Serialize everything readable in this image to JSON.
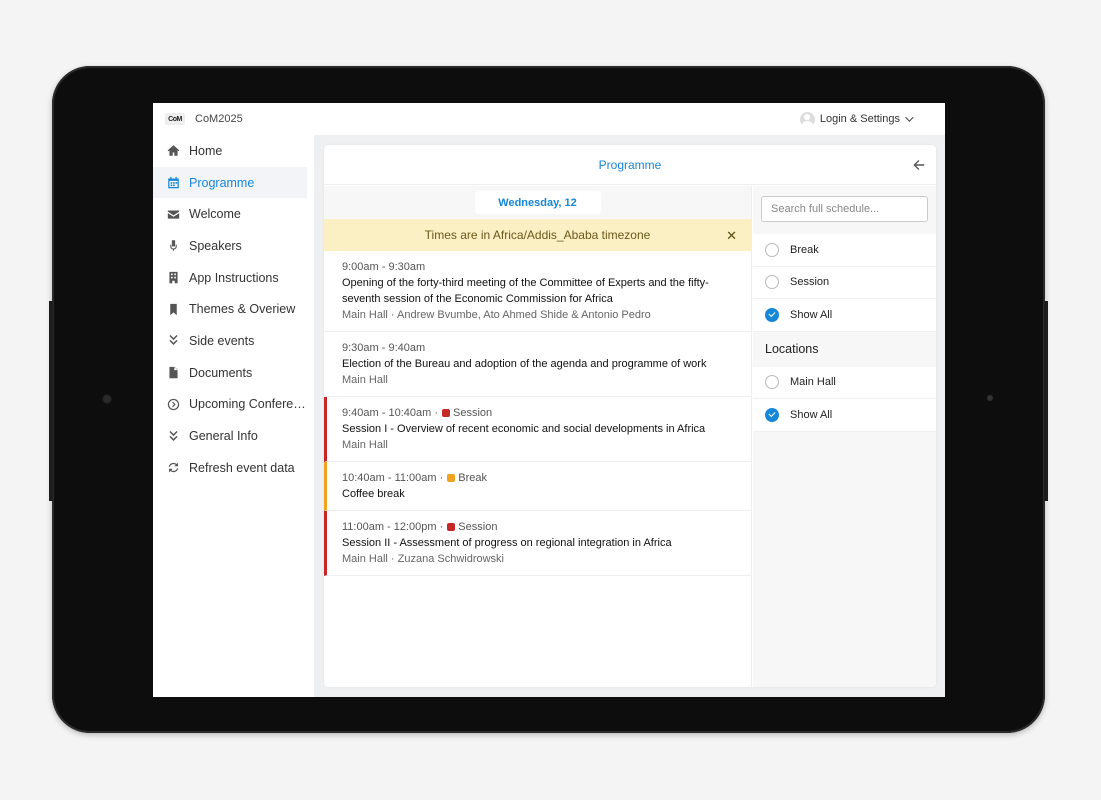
{
  "app": {
    "logo_text": "CoM",
    "title": "CoM2025",
    "login_label": "Login & Settings"
  },
  "sidebar": {
    "items": [
      {
        "label": "Home"
      },
      {
        "label": "Programme"
      },
      {
        "label": "Welcome"
      },
      {
        "label": "Speakers"
      },
      {
        "label": "App Instructions"
      },
      {
        "label": "Themes & Overiew"
      },
      {
        "label": "Side events"
      },
      {
        "label": "Documents"
      },
      {
        "label": "Upcoming Conferences"
      },
      {
        "label": "General Info"
      },
      {
        "label": "Refresh event data"
      }
    ]
  },
  "programme": {
    "title": "Programme",
    "day_tab": "Wednesday, 12",
    "timezone_notice": "Times are in Africa/Addis_Ababa timezone",
    "events": [
      {
        "time": "9:00am - 9:30am",
        "title": "Opening of the forty-third meeting of the Committee of Experts and the fifty-seventh session of the Economic Commission for Africa",
        "meta": "Main Hall · Andrew Bvumbe, Ato Ahmed Shide & Antonio Pedro"
      },
      {
        "time": "9:30am - 9:40am",
        "title": "Election of the Bureau and adoption of the agenda and programme of work",
        "meta": "Main Hall"
      },
      {
        "time": "9:40am - 10:40am ·",
        "tag": "Session",
        "title": "Session I - Overview of recent economic and social developments in Africa",
        "meta": "Main Hall"
      },
      {
        "time": "10:40am - 11:00am ·",
        "tag": "Break",
        "title": "Coffee break"
      },
      {
        "time": "11:00am - 12:00pm ·",
        "tag": "Session",
        "title": "Session II - Assessment of progress on regional integration in Africa",
        "meta": "Main Hall · Zuzana Schwidrowski"
      }
    ]
  },
  "filters": {
    "search_placeholder": "Search full schedule...",
    "types": [
      {
        "label": "Break",
        "checked": false
      },
      {
        "label": "Session",
        "checked": false
      },
      {
        "label": "Show All",
        "checked": true
      }
    ],
    "locations_heading": "Locations",
    "locations": [
      {
        "label": "Main Hall",
        "checked": false
      },
      {
        "label": "Show All",
        "checked": true
      }
    ]
  },
  "colors": {
    "accent": "#1787d8",
    "session": "#c62828",
    "break": "#f0a320",
    "notice_bg": "#fbefc4"
  }
}
